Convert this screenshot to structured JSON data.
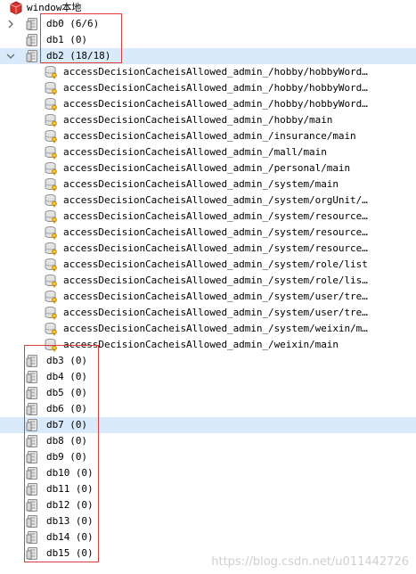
{
  "root": {
    "label": "window本地"
  },
  "dbs_top": [
    {
      "label": "db0 (6/6)",
      "expanded": false
    },
    {
      "label": "db1 (0)",
      "expanded": null
    },
    {
      "label": "db2 (18/18)",
      "expanded": true
    }
  ],
  "keys": [
    "accessDecisionCacheisAllowed_admin_/hobby/hobbyWord…",
    "accessDecisionCacheisAllowed_admin_/hobby/hobbyWord…",
    "accessDecisionCacheisAllowed_admin_/hobby/hobbyWord…",
    "accessDecisionCacheisAllowed_admin_/hobby/main",
    "accessDecisionCacheisAllowed_admin_/insurance/main",
    "accessDecisionCacheisAllowed_admin_/mall/main",
    "accessDecisionCacheisAllowed_admin_/personal/main",
    "accessDecisionCacheisAllowed_admin_/system/main",
    "accessDecisionCacheisAllowed_admin_/system/orgUnit/…",
    "accessDecisionCacheisAllowed_admin_/system/resource…",
    "accessDecisionCacheisAllowed_admin_/system/resource…",
    "accessDecisionCacheisAllowed_admin_/system/resource…",
    "accessDecisionCacheisAllowed_admin_/system/role/list",
    "accessDecisionCacheisAllowed_admin_/system/role/lis…",
    "accessDecisionCacheisAllowed_admin_/system/user/tre…",
    "accessDecisionCacheisAllowed_admin_/system/user/tre…",
    "accessDecisionCacheisAllowed_admin_/system/weixin/m…",
    "accessDecisionCacheisAllowed_admin_/weixin/main"
  ],
  "dbs_bottom": [
    "db3 (0)",
    "db4 (0)",
    "db5 (0)",
    "db6 (0)",
    "db7 (0)",
    "db8 (0)",
    "db9 (0)",
    "db10 (0)",
    "db11 (0)",
    "db12 (0)",
    "db13 (0)",
    "db14 (0)",
    "db15 (0)"
  ],
  "watermark": "https://blog.csdn.net/u011442726",
  "colors": {
    "selection": "#d9ebfb",
    "annotation_box": "#e03a3a",
    "server_icon": "#d7322e",
    "key_icon": "#e0a800"
  }
}
